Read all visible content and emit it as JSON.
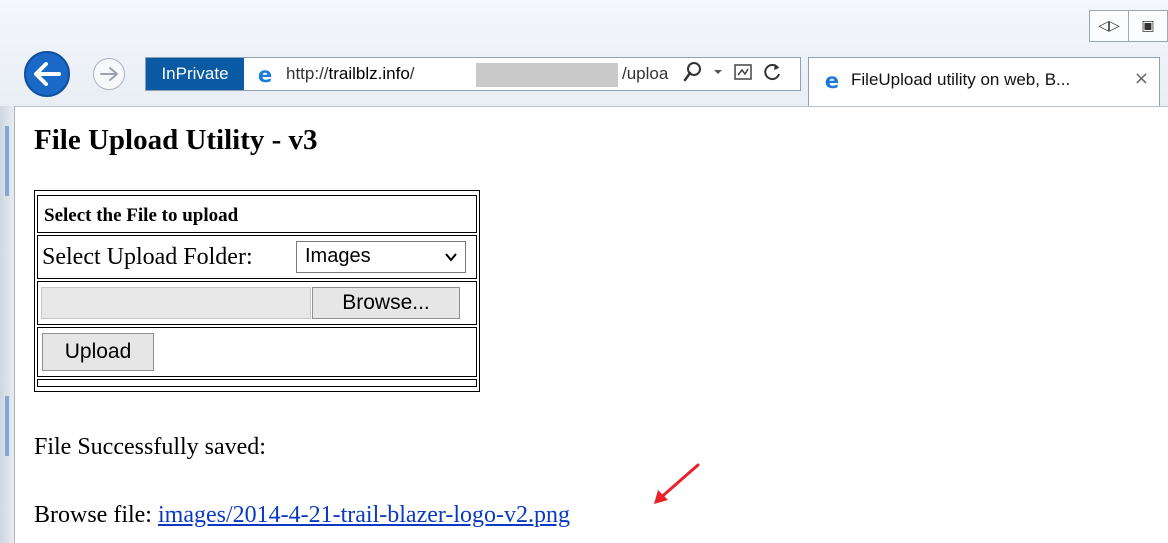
{
  "browser": {
    "inprivate_label": "InPrivate",
    "url_prefix": "http://",
    "url_domain": "trailblz.info",
    "url_slash": "/",
    "url_tail": "/uploa",
    "tab_title": "FileUpload utility on web, B...",
    "tab_close": "×"
  },
  "page": {
    "title": "File Upload Utility - v3",
    "form": {
      "header": "Select the File to upload",
      "folder_label": "Select Upload Folder:",
      "folder_selected": "Images",
      "browse_label": "Browse...",
      "upload_label": "Upload"
    },
    "saved_message": "File Successfully saved:",
    "browse_file_label": "Browse file:",
    "file_link": "images/2014-4-21-trail-blazer-logo-v2.png"
  },
  "colors": {
    "link": "#0a39c4",
    "annotation_arrow": "#e8212b",
    "inprivate_bg": "#0a5aa4"
  },
  "icons": [
    "back-arrow-icon",
    "forward-arrow-icon",
    "ie-logo-icon",
    "search-icon",
    "dropdown-icon",
    "compat-view-icon",
    "refresh-icon",
    "close-icon",
    "chevron-down-icon"
  ]
}
